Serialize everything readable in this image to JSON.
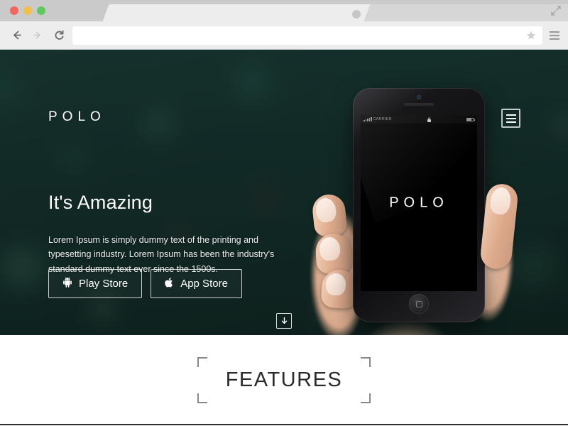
{
  "browser": {
    "traffic_lights": [
      {
        "name": "close",
        "color": "#f1675f"
      },
      {
        "name": "minimize",
        "color": "#f0c04a"
      },
      {
        "name": "maximize",
        "color": "#5ec95e"
      }
    ],
    "tabs": [
      {
        "title": "",
        "active": true
      },
      {
        "title": "",
        "active": false
      }
    ],
    "toolbar": {
      "back_label": "Back",
      "forward_label": "Forward",
      "reload_label": "Reload",
      "bookmark_label": "Bookmark",
      "menu_label": "Menu",
      "fullscreen_label": "Full screen"
    },
    "address_bar": {
      "value": "",
      "placeholder": ""
    }
  },
  "site": {
    "logo": "POLO",
    "nav_toggle_label": "Menu",
    "hero": {
      "title": "It's Amazing",
      "paragraph": "Lorem Ipsum is simply dummy text of the printing and typesetting industry. Lorem Ipsum has been the industry's standard dummy text ever since the 1500s.",
      "buttons": [
        {
          "label": "Play Store",
          "icon": "android-icon"
        },
        {
          "label": "App Store",
          "icon": "apple-icon"
        }
      ],
      "scroll_hint": "Scroll down",
      "phone": {
        "screen_logo": "POLO",
        "status_carrier": "CARRIER",
        "status_lock": "lock-icon",
        "status_battery": "battery-icon"
      }
    },
    "features": {
      "title": "FEATURES"
    }
  },
  "colors": {
    "hero_bg": "#17302c",
    "chrome_tabbar": "#cacaca",
    "chrome_toolbar": "#ededed",
    "text_light": "#ffffff",
    "features_text": "#2b2b2b"
  }
}
